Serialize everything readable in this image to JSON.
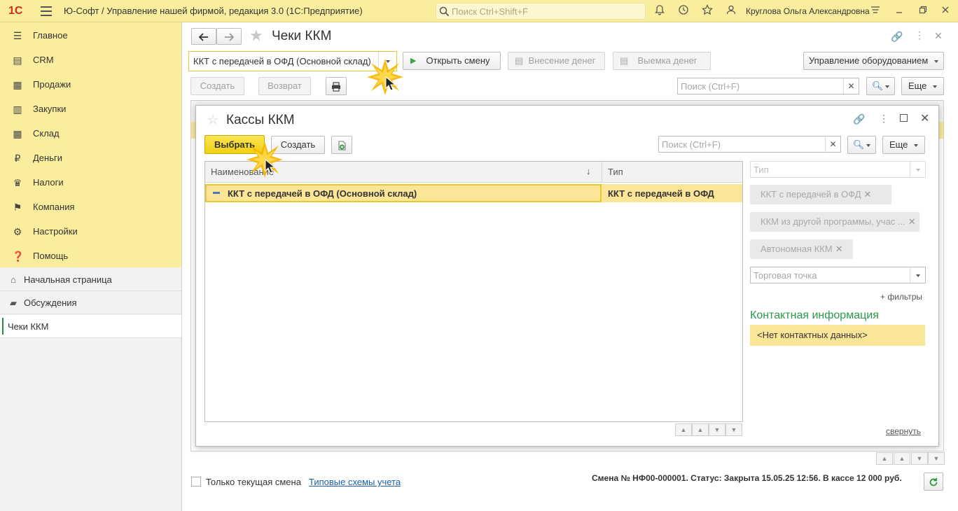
{
  "app": {
    "logo": "1С",
    "title": "Ю-Софт / Управление нашей фирмой, редакция 3.0  (1С:Предприятие)",
    "search_placeholder": "Поиск Ctrl+Shift+F",
    "user": "Круглова Ольга Александровна"
  },
  "sidebar": {
    "sections": [
      {
        "label": "Главное",
        "icon": "menu-lines-icon"
      },
      {
        "label": "CRM",
        "icon": "crm-icon"
      },
      {
        "label": "Продажи",
        "icon": "basket-icon"
      },
      {
        "label": "Закупки",
        "icon": "purchases-icon"
      },
      {
        "label": "Склад",
        "icon": "warehouse-icon"
      },
      {
        "label": "Деньги",
        "icon": "money-icon"
      },
      {
        "label": "Налоги",
        "icon": "taxes-icon"
      },
      {
        "label": "Компания",
        "icon": "flag-icon"
      },
      {
        "label": "Настройки",
        "icon": "gear-icon"
      },
      {
        "label": "Помощь",
        "icon": "help-icon"
      }
    ],
    "nav": [
      {
        "label": "Начальная страница",
        "icon": "home-icon"
      },
      {
        "label": "Обсуждения",
        "icon": "discussions-icon"
      },
      {
        "label": "Чеки ККМ",
        "icon": ""
      }
    ]
  },
  "main": {
    "title": "Чеки ККМ",
    "kkm_select_value": "ККТ с передачей в ОФД (Основной склад)",
    "open_shift": "Открыть смену",
    "deposit": "Внесение денег",
    "withdraw": "Выемка денег",
    "equipment": "Управление оборудованием",
    "create": "Создать",
    "return": "Возврат",
    "search_placeholder": "Поиск (Ctrl+F)",
    "more": "Еще",
    "only_current_shift": "Только текущая смена",
    "typical_schemes": "Типовые схемы учета",
    "status": "Смена № НФ00-000001. Статус: Закрыта 15.05.25 12:56. В кассе 12 000 руб."
  },
  "dialog": {
    "title": "Кассы ККМ",
    "select": "Выбрать",
    "create": "Создать",
    "search_placeholder": "Поиск (Ctrl+F)",
    "more": "Еще",
    "columns": {
      "name": "Наименование",
      "type": "Тип"
    },
    "rows": [
      {
        "name": "ККТ с передачей в ОФД (Основной склад)",
        "type": "ККТ с передачей в ОФД"
      }
    ],
    "filter": {
      "type_placeholder": "Тип",
      "tags": [
        "ККТ с передачей в ОФД",
        "ККМ из другой программы, учас ...",
        "Автономная ККМ"
      ],
      "point_placeholder": "Торговая точка",
      "more_filters": "+ фильтры",
      "contact_title": "Контактная информация",
      "contact_value": "<Нет контактных данных>",
      "collapse": "свернуть"
    }
  }
}
